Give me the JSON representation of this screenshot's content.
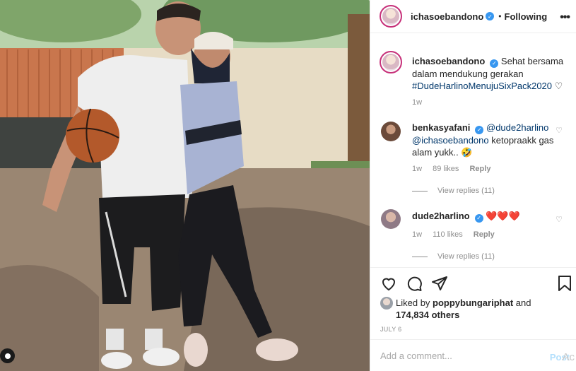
{
  "post": {
    "author": "ichasoebandono",
    "follow_status": "Following",
    "dot": "•",
    "caption": {
      "text": "Sehat bersama dalam mendukung gerakan",
      "hashtag": "#DudeHarlinoMenujuSixPack2020",
      "heart": "♡",
      "time": "1w"
    },
    "comments": [
      {
        "user": "benkasyafani",
        "mention1": "@dude2harlino",
        "mention2": "@ichasoebandono",
        "text": "ketopraakk gas alam yukk..",
        "emoji": "🤣",
        "time": "1w",
        "likes": "89 likes",
        "reply": "Reply",
        "view_replies": "View replies (11)"
      },
      {
        "user": "dude2harlino",
        "text": "❤️❤️❤️",
        "time": "1w",
        "likes": "110 likes",
        "reply": "Reply",
        "view_replies": "View replies (11)"
      }
    ],
    "liked_by_prefix": "Liked by",
    "liked_by_user": "poppybungariphat",
    "liked_by_and": "and",
    "liked_by_others": "174,834 others",
    "date": "JULY 6",
    "add_comment_placeholder": "Add a comment...",
    "post_label": "Post",
    "watermark": "Ac"
  },
  "icons": {
    "more": "more-horizontal-icon",
    "like": "heart-icon",
    "comment": "comment-icon",
    "share": "share-icon",
    "save": "bookmark-icon",
    "verified": "verified-badge-icon"
  },
  "colors": {
    "link": "#00376b",
    "verified": "#3897f0",
    "muted": "#8e8e8e",
    "heart": "#ed4956",
    "post_button": "#b2dffc"
  }
}
